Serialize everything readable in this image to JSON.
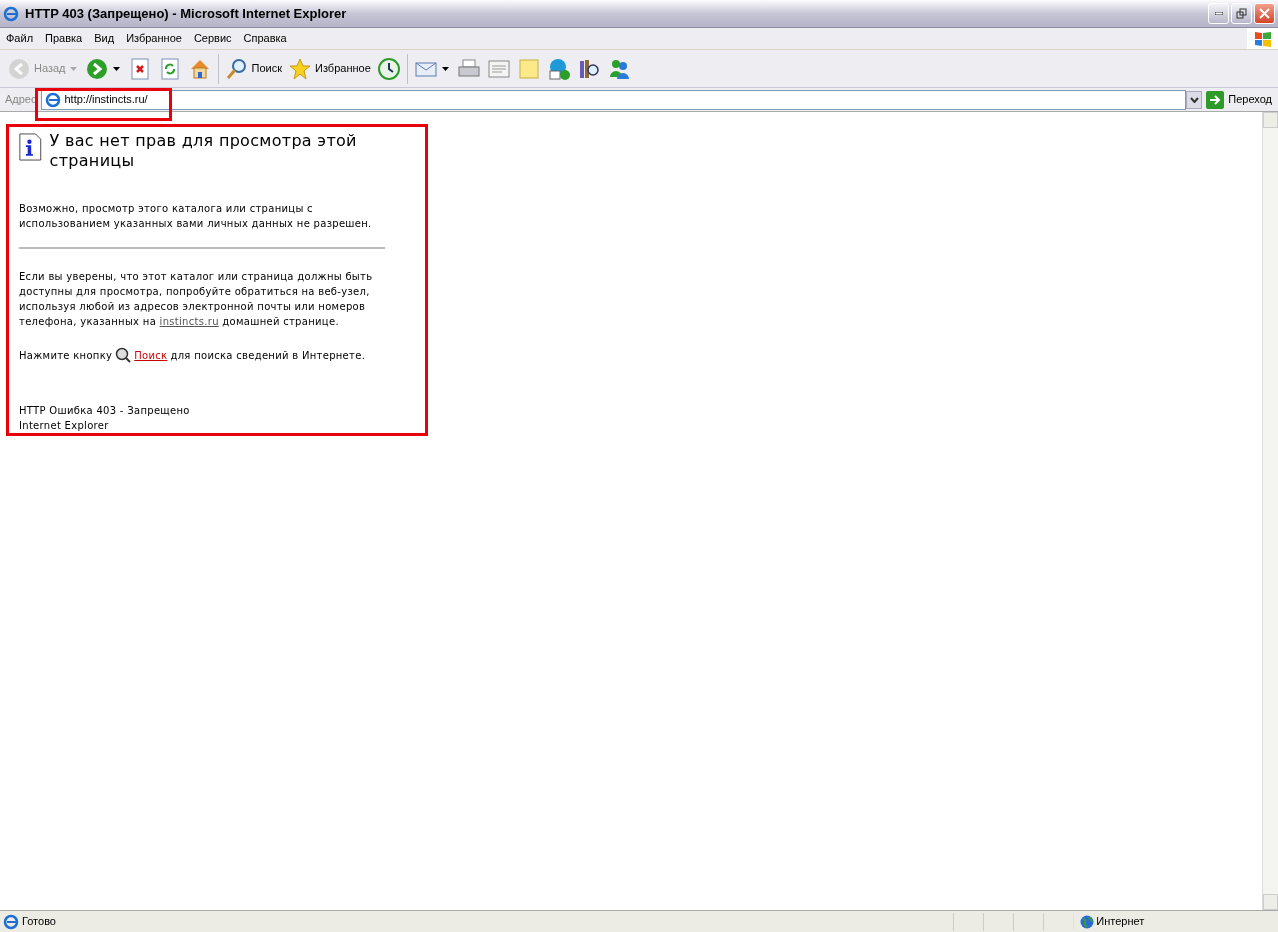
{
  "window": {
    "title": "HTTP 403 (Запрещено) - Microsoft Internet Explorer"
  },
  "menu": [
    "Файл",
    "Правка",
    "Вид",
    "Избранное",
    "Сервис",
    "Справка"
  ],
  "toolbar": [
    {
      "kind": "back",
      "label": "Назад",
      "disabled": true,
      "dropdown": true
    },
    {
      "kind": "forward",
      "disabled": false,
      "dropdown": true
    },
    {
      "kind": "stop",
      "disabled": false
    },
    {
      "kind": "refresh",
      "disabled": false
    },
    {
      "kind": "home",
      "disabled": false
    },
    {
      "kind": "separator"
    },
    {
      "kind": "search",
      "label": "Поиск",
      "disabled": false
    },
    {
      "kind": "favorites",
      "label": "Избранное",
      "disabled": false
    },
    {
      "kind": "history",
      "disabled": false
    },
    {
      "kind": "separator"
    },
    {
      "kind": "mail",
      "disabled": false,
      "dropdown": true
    },
    {
      "kind": "print",
      "disabled": false
    },
    {
      "kind": "edit",
      "disabled": false
    },
    {
      "kind": "note",
      "disabled": false
    },
    {
      "kind": "skype",
      "disabled": false
    },
    {
      "kind": "research",
      "disabled": false
    },
    {
      "kind": "messenger",
      "disabled": false
    }
  ],
  "address_bar": {
    "label": "Адрес",
    "value": "http://instincts.ru/",
    "go_button": "Переход"
  },
  "page": {
    "heading": "У вас нет прав для просмотра этой страницы",
    "paragraph_1": "Возможно, просмотр этого каталога или страницы с использованием указанных вами личных данных не разрешен.",
    "paragraph_2": {
      "before": "Если вы уверены, что этот каталог или страница должны быть доступны для просмотра, попробуйте обратиться на веб-узел, используя любой из адресов электронной почты или номеров телефона, указанных на",
      "link": "instincts.ru",
      "after": "домашней странице."
    },
    "search_line": {
      "before": "Нажмите кнопку",
      "link": "Поиск",
      "after": "для поиска сведений в Интернете."
    },
    "footer": [
      "HTTP Ошибка 403 - Запрещено",
      "Internet Explorer"
    ]
  },
  "highlights": {
    "address": true,
    "page_content": true
  },
  "status_bar": {
    "text": "Готово",
    "zone": "Интернет"
  }
}
